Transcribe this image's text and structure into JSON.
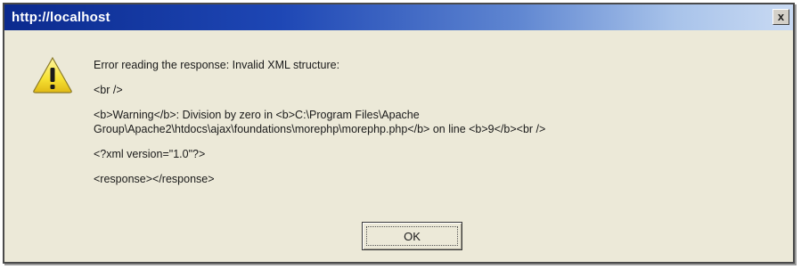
{
  "window": {
    "title": "http://localhost",
    "close_label": "x"
  },
  "message": {
    "lines": [
      "Error reading the response: Invalid XML structure:",
      "<br />",
      "<b>Warning</b>: Division by zero in <b>C:\\Program Files\\Apache",
      "Group\\Apache2\\htdocs\\ajax\\foundations\\morephp\\morephp.php</b> on line <b>9</b><br />",
      "<?xml version=\"1.0\"?>",
      "<response></response>"
    ]
  },
  "buttons": {
    "ok_label": "OK"
  },
  "icons": {
    "warning": "warning-triangle-icon",
    "close": "close-icon"
  },
  "colors": {
    "titlebar_start": "#0b2a8e",
    "titlebar_end": "#c9daf3",
    "dialog_bg": "#ece9d8",
    "warning_fill": "#f7e233"
  }
}
